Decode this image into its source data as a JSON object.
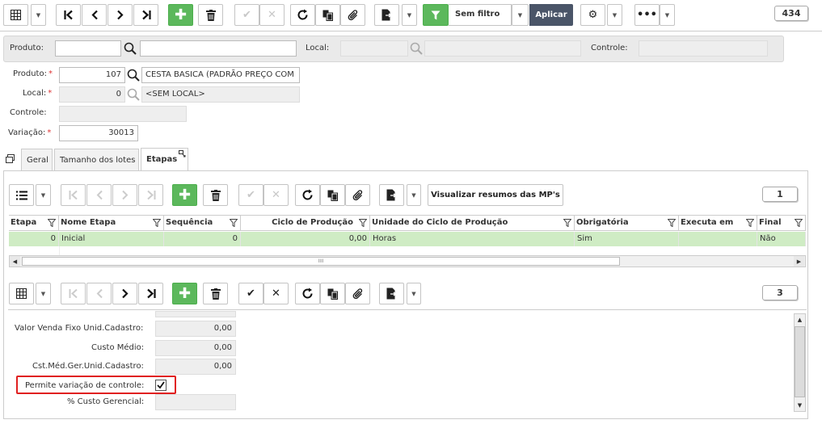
{
  "toolbar": {
    "filter_label": "Sem filtro",
    "apply_label": "Aplicar",
    "record_count": "434"
  },
  "filterbar": {
    "produto_label": "Produto:",
    "local_label": "Local:",
    "controle_label": "Controle:"
  },
  "form": {
    "produto_label": "Produto:",
    "produto_code": "107",
    "produto_desc": "CESTA BASICA (PADRÃO PREÇO COM",
    "local_label": "Local:",
    "local_code": "0",
    "local_desc": "<SEM LOCAL>",
    "controle_label": "Controle:",
    "variacao_label": "Variação:",
    "variacao_value": "30013",
    "required_mark": "*"
  },
  "tabs": [
    "Geral",
    "Tamanho dos lotes",
    "Etapas"
  ],
  "etapas_toolbar": {
    "summary_button": "Visualizar resumos das MP's",
    "count": "1"
  },
  "grid": {
    "columns": [
      "Etapa",
      "Nome Etapa",
      "Sequência",
      "Ciclo de Produção",
      "Unidade do Ciclo de Produção",
      "Obrigatória",
      "Executa em",
      "Final"
    ],
    "rows": [
      [
        "0",
        "Inicial",
        "0",
        "0,00",
        "Horas",
        "Sim",
        "",
        "Não"
      ]
    ],
    "scroll_grip": "IIII"
  },
  "detail_toolbar": {
    "count": "3"
  },
  "detail": {
    "valor_venda_label": "Valor Venda Fixo Unid.Cadastro:",
    "valor_venda": "0,00",
    "custo_medio_label": "Custo Médio:",
    "custo_medio": "0,00",
    "cst_med_label": "Cst.Méd.Ger.Unid.Cadastro:",
    "cst_med": "0,00",
    "permite_label": "Permite variação de controle:",
    "permite_checked": true,
    "custo_gerencial_label": "% Custo Gerencial:"
  },
  "colors": {
    "green": "#5cb85c",
    "apply": "#4a5568",
    "row_selected": "#cfecc4",
    "highlight": "#e02020"
  }
}
